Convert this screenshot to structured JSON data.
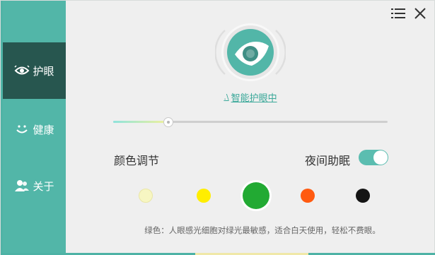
{
  "window": {
    "menu_icon": "list-menu-icon",
    "close_icon": "close-icon"
  },
  "sidebar": {
    "items": [
      {
        "label": "护眼",
        "icon": "eye-protection-icon",
        "active": true
      },
      {
        "label": "健康",
        "icon": "smile-icon",
        "active": false
      },
      {
        "label": "关于",
        "icon": "users-icon",
        "active": false
      }
    ]
  },
  "main": {
    "logo_icon": "eye-logo-icon",
    "mode_label": "智能护眼中",
    "brightness_slider": {
      "value": 0.2
    },
    "color_section_title": "颜色调节",
    "night_mode_label": "夜间助眠",
    "night_mode_on": true,
    "swatches": [
      {
        "name": "light-yellow",
        "color": "#f7f6c2",
        "selected": false
      },
      {
        "name": "yellow",
        "color": "#ffee00",
        "selected": false
      },
      {
        "name": "green",
        "color": "#22aa33",
        "selected": true
      },
      {
        "name": "orange",
        "color": "#ff5a10",
        "selected": false
      },
      {
        "name": "black",
        "color": "#141414",
        "selected": false
      }
    ],
    "hint": "绿色：人眼感光细胞对绿光最敏感，适合白天使用，轻松不费眼。"
  },
  "colors": {
    "accent": "#52b6a8",
    "sidebar_active": "#27564f"
  }
}
